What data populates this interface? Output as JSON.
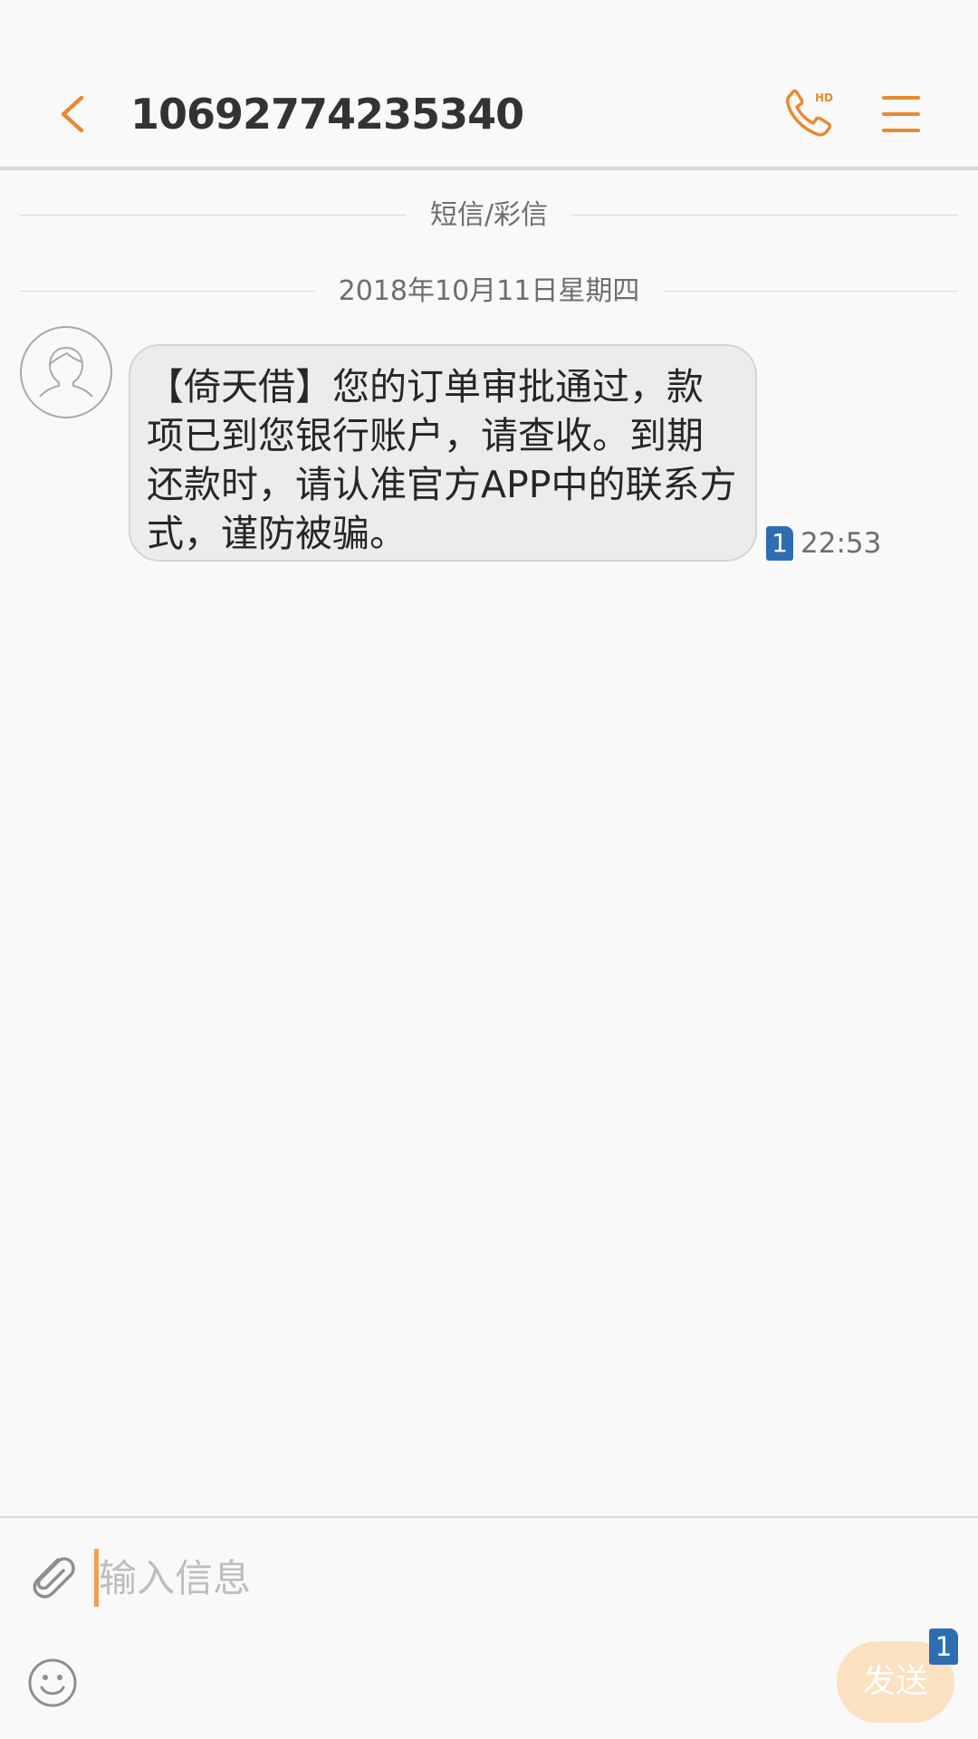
{
  "header": {
    "title": "10692774235340",
    "back_icon": "chevron-left-icon",
    "call_icon": "hd-call-icon",
    "call_badge": "HD",
    "menu_icon": "menu-icon"
  },
  "colors": {
    "accent": "#e98a2f",
    "sim_badge": "#2f6db3",
    "bubble_bg": "#ececec",
    "send_button_bg": "#fbe1bf"
  },
  "conversation": {
    "type_label": "短信/彩信",
    "date_label": "2018年10月11日星期四",
    "messages": [
      {
        "text": "【倚天借】您的订单审批通过，款项已到您银行账户，请查收。到期还款时，请认准官方APP中的联系方式，谨防被骗。",
        "sim": "1",
        "time": "22:53"
      }
    ]
  },
  "composer": {
    "placeholder": "输入信息",
    "attach_icon": "paperclip-icon",
    "emoji_icon": "smiley-icon",
    "send_label": "发送",
    "send_sim": "1"
  }
}
